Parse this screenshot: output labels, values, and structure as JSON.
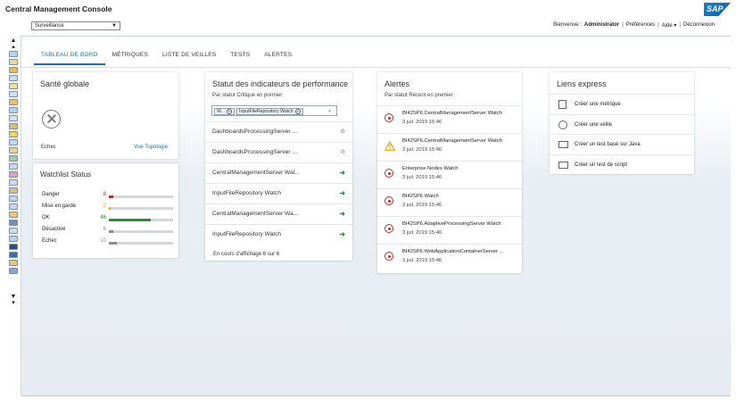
{
  "app": {
    "title": "Central Management Console",
    "logo": "SAP"
  },
  "context_select": {
    "value": "Surveillance"
  },
  "userbar": {
    "welcome": "Bienvenue :",
    "user": "Administrator",
    "preferences": "Préférences",
    "help": "Aide",
    "help_caret": "▾",
    "logout": "Déconnexion"
  },
  "tabs": [
    {
      "label": "TABLEAU DE BORD",
      "active": true
    },
    {
      "label": "MÉTRIQUES"
    },
    {
      "label": "LISTE DE VEILLES"
    },
    {
      "label": "TESTS"
    },
    {
      "label": "ALERTES"
    }
  ],
  "health": {
    "title": "Santé globale",
    "status": "Echec",
    "topology_link": "Vue Topologie"
  },
  "watchlist": {
    "title": "Watchlist Status",
    "rows": [
      {
        "label": "Danger",
        "count": "8",
        "color": "#d0271d",
        "fraction": 0.07
      },
      {
        "label": "Mise en garde",
        "count": "2",
        "color": "#e8a317",
        "fraction": 0.03
      },
      {
        "label": "OK",
        "count": "46",
        "color": "#2e8a3c",
        "fraction": 0.65
      },
      {
        "label": "Désactivé",
        "count": "6",
        "color": "#8a8f95",
        "fraction": 0.07
      },
      {
        "label": "Echec",
        "count": "10",
        "color": "#8a8f95",
        "fraction": 0.13
      }
    ]
  },
  "kpi": {
    "title": "Statut des indicateurs de performance",
    "subtitle": "Par statut Critique en premier",
    "filter_chips": [
      "W...",
      "InputFileRepository Watch"
    ],
    "rows": [
      {
        "label": "DashboardsProcessingServer ...",
        "status": "blocked"
      },
      {
        "label": "DashboardsProcessingServer ...",
        "status": "blocked"
      },
      {
        "label": "CentralManagementServer Wat...",
        "status": "arrow"
      },
      {
        "label": "InputFileRepository Watch",
        "status": "arrow"
      },
      {
        "label": "CentralManagementServer Wa...",
        "status": "arrow"
      },
      {
        "label": "InputFileRepository Watch",
        "status": "arrow"
      }
    ],
    "footer": "En cours d'affichage 6 sur 6"
  },
  "alerts": {
    "title": "Alertes",
    "subtitle": "Par statut Récent en premier",
    "rows": [
      {
        "icon": "critical-icon",
        "name": "BI42SP6.CentralManagementServer Watch",
        "date": "3 juil. 2019 15:46"
      },
      {
        "icon": "warning-icon",
        "name": "BI42SP6.CentralManagementServer Watch",
        "date": "3 juil. 2019 15:46"
      },
      {
        "icon": "critical-icon",
        "name": "Enterprise Nodes Watch",
        "date": "3 juil. 2019 15:46"
      },
      {
        "icon": "critical-icon",
        "name": "BI42SP6 Watch",
        "date": "3 juil. 2019 15:46"
      },
      {
        "icon": "critical-icon",
        "name": "BI42SP6.AdaptiveProcessingServer Watch",
        "date": "3 juil. 2019 15:46"
      },
      {
        "icon": "critical-icon",
        "name": "BI42SP6.WebApplicationContainerServer ...",
        "date": "3 juil. 2019 15:46"
      }
    ]
  },
  "quick_links": {
    "title": "Liens express",
    "rows": [
      {
        "icon": "document-icon",
        "label": "Créer une métrique"
      },
      {
        "icon": "stopwatch-icon",
        "label": "Créer une veille"
      },
      {
        "icon": "script-icon",
        "label": "Créer un test basé sur Java"
      },
      {
        "icon": "script-icon",
        "label": "Créer un test de script"
      }
    ]
  }
}
